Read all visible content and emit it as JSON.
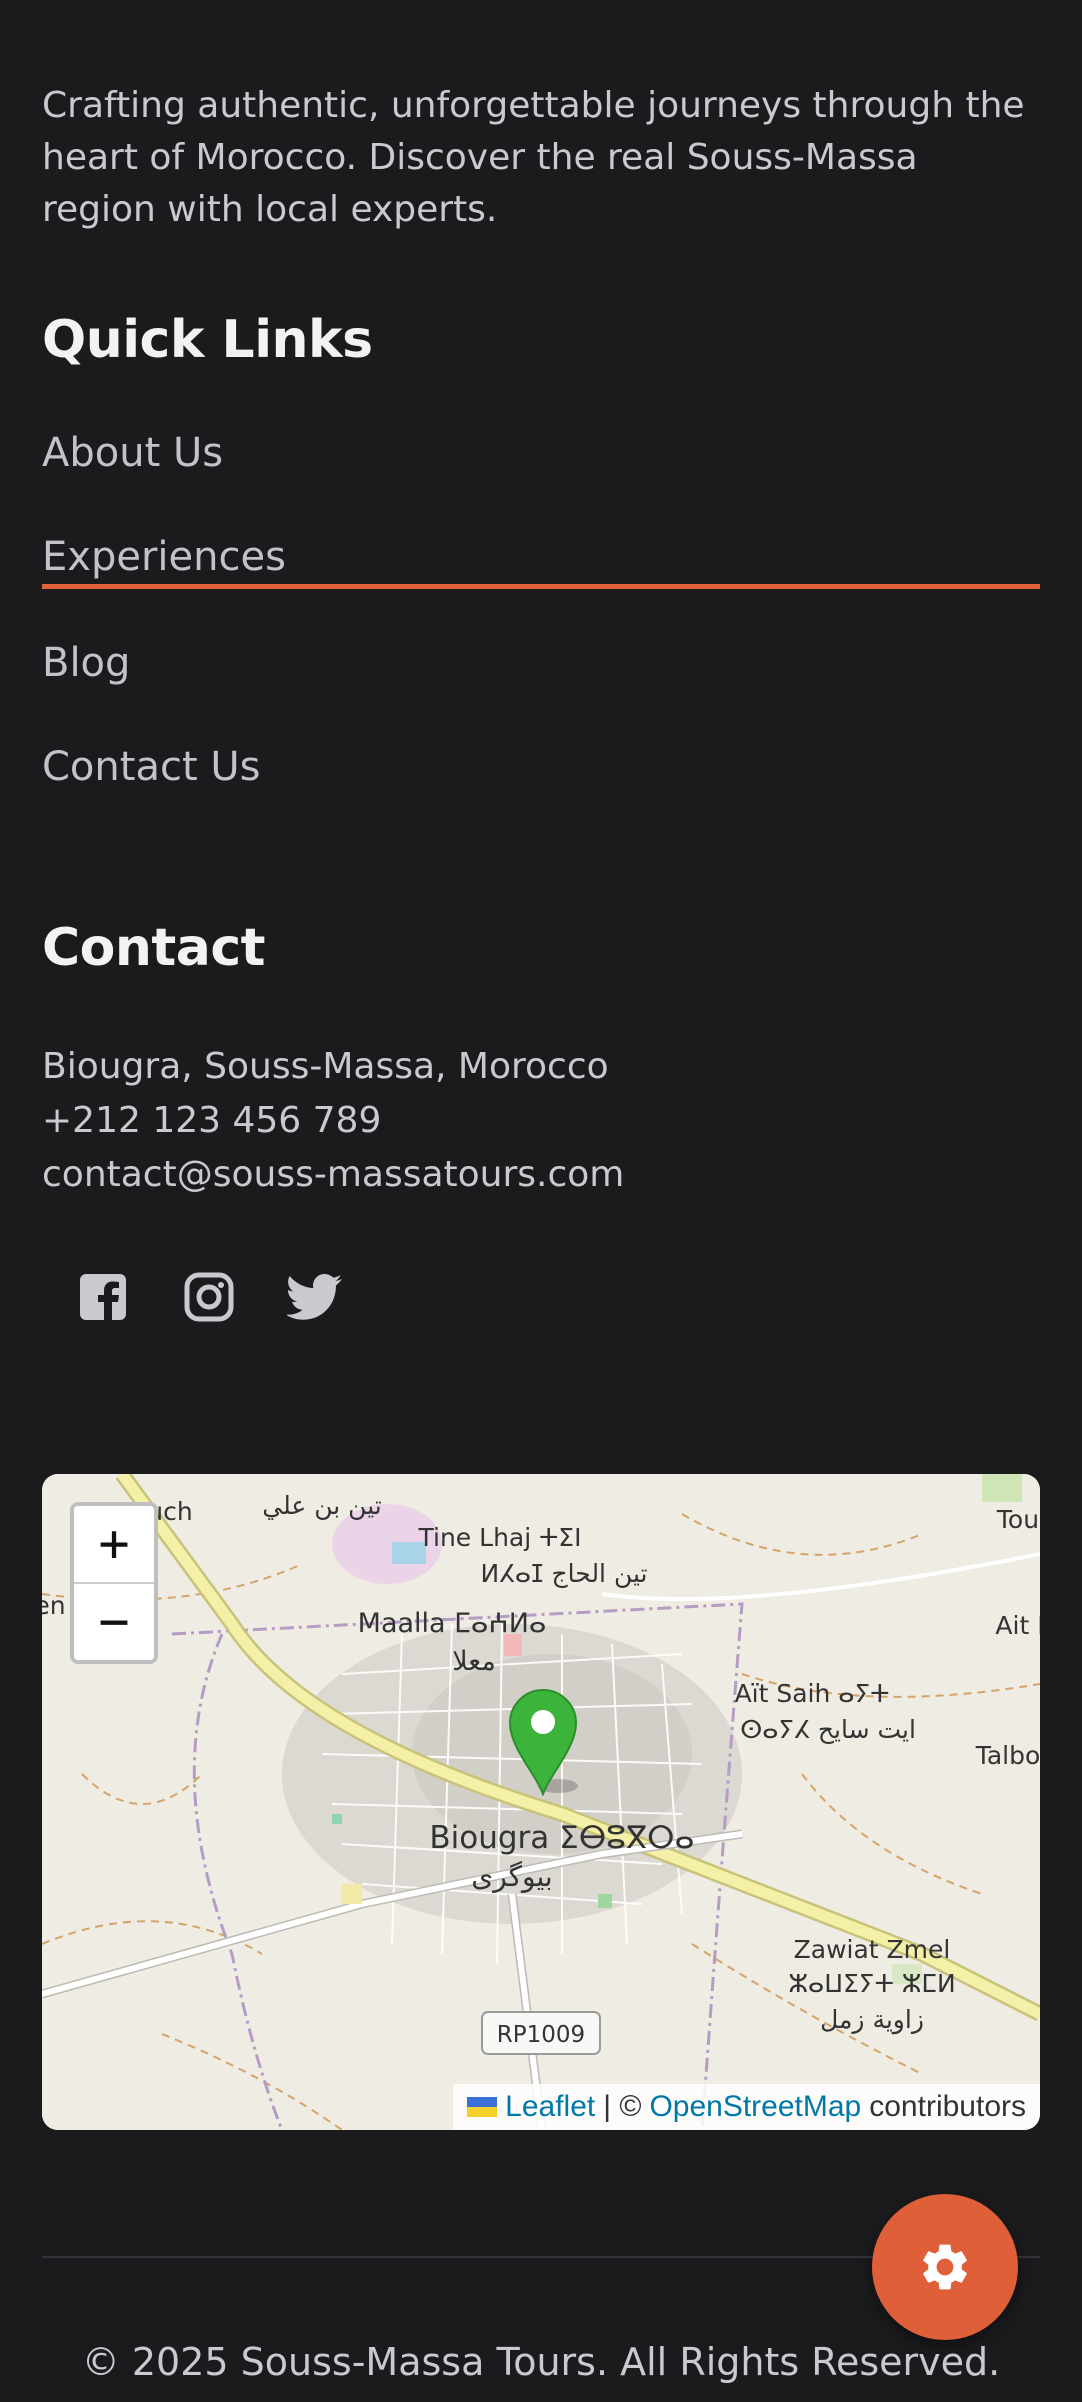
{
  "about": {
    "text": "Crafting authentic, unforgettable journeys through the heart of Morocco. Discover the real Souss-Massa region with local experts."
  },
  "quick_links": {
    "title": "Quick Links",
    "items": [
      {
        "label": "About Us"
      },
      {
        "label": "Experiences",
        "active": true
      },
      {
        "label": "Blog"
      },
      {
        "label": "Contact Us"
      }
    ]
  },
  "contact": {
    "title": "Contact",
    "address": "Biougra, Souss-Massa, Morocco",
    "phone": "+212 123 456 789",
    "email": "contact@souss-massatours.com"
  },
  "social": [
    {
      "icon": "facebook-icon"
    },
    {
      "icon": "instagram-icon"
    },
    {
      "icon": "twitter-icon"
    }
  ],
  "map": {
    "zoom_in": "+",
    "zoom_out": "−",
    "labels": {
      "town_main": "Biougra ⵉⴱⵓⴳⵔⴰ",
      "town_main_ar": "بيوگرى",
      "tine_lhaj": "Tine Lhaj ⵜⵉⵏ",
      "tine_lhaj_2": "ⵍⵃⴰⵊ تين الحاج",
      "maalla": "Maalla ⵎⴰⵄⵍⴰ",
      "maalla_ar": "معلا",
      "ait_saih": "Aït Saih ⴰⵢⵜ",
      "ait_saih_2": "ⵙⴰⵢⵃ ايت سايح",
      "zawiat": "Zawiat Zmel",
      "zawiat_2": "ⵣⴰⵡⵉⵢⵜ ⵣⵎⵍ",
      "zawiat_ar": "زاوية زمل",
      "road": "RP1009",
      "tine_ali": "تين بن علي",
      "talbo": "Talbo",
      "tou": "Tou",
      "ait_right": "Ait I",
      "uch": "uch",
      "en": "en"
    },
    "attribution": {
      "leaflet": "Leaflet",
      "sep": "| ©",
      "osm": "OpenStreetMap",
      "contributors": "contributors"
    }
  },
  "footer": {
    "copyright": "© 2025 Souss-Massa Tours. All Rights Reserved."
  },
  "fab": {
    "icon": "gear-icon"
  },
  "colors": {
    "accent": "#df5f39",
    "background": "#1b1b1e",
    "marker": "#3cb43c"
  }
}
